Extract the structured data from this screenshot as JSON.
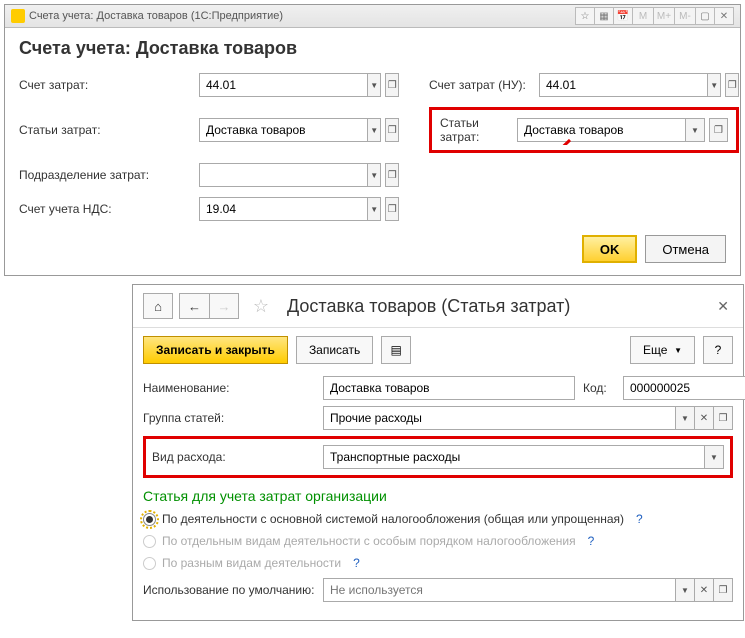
{
  "window1": {
    "title": "Счета учета: Доставка товаров   (1С:Предприятие)",
    "heading": "Счета учета: Доставка товаров",
    "labels": {
      "schet_zatrat": "Счет затрат:",
      "stati_zatrat": "Статьи затрат:",
      "podrazdelenie": "Подразделение затрат:",
      "schet_nds": "Счет учета НДС:",
      "schet_zatrat_nu": "Счет затрат (НУ):",
      "stati_zatrat2": "Статьи затрат:"
    },
    "values": {
      "schet_zatrat": "44.01",
      "stati_zatrat": "Доставка товаров",
      "podrazdelenie": "",
      "schet_nds": "19.04",
      "schet_zatrat_nu": "44.01",
      "stati_zatrat2": "Доставка товаров"
    },
    "buttons": {
      "ok": "OK",
      "cancel": "Отмена"
    },
    "tb_icons": {
      "m": "M",
      "mp": "M+",
      "mm": "M-"
    }
  },
  "window2": {
    "title": "Доставка товаров (Статья затрат)",
    "buttons": {
      "save_close": "Записать и закрыть",
      "save": "Записать",
      "more": "Еще"
    },
    "labels": {
      "name": "Наименование:",
      "group": "Группа статей:",
      "vid": "Вид расхода:",
      "code": "Код:",
      "usage": "Использование по умолчанию:"
    },
    "values": {
      "name": "Доставка товаров",
      "group": "Прочие расходы",
      "vid": "Транспортные расходы",
      "code": "000000025",
      "usage_placeholder": "Не используется"
    },
    "section_title": "Статья для учета затрат организации",
    "radios": {
      "r1": "По деятельности с основной системой налогообложения (общая или упрощенная)",
      "r2": "По отдельным видам деятельности с особым порядком налогообложения",
      "r3": "По разным видам деятельности"
    },
    "qmark": "?"
  }
}
